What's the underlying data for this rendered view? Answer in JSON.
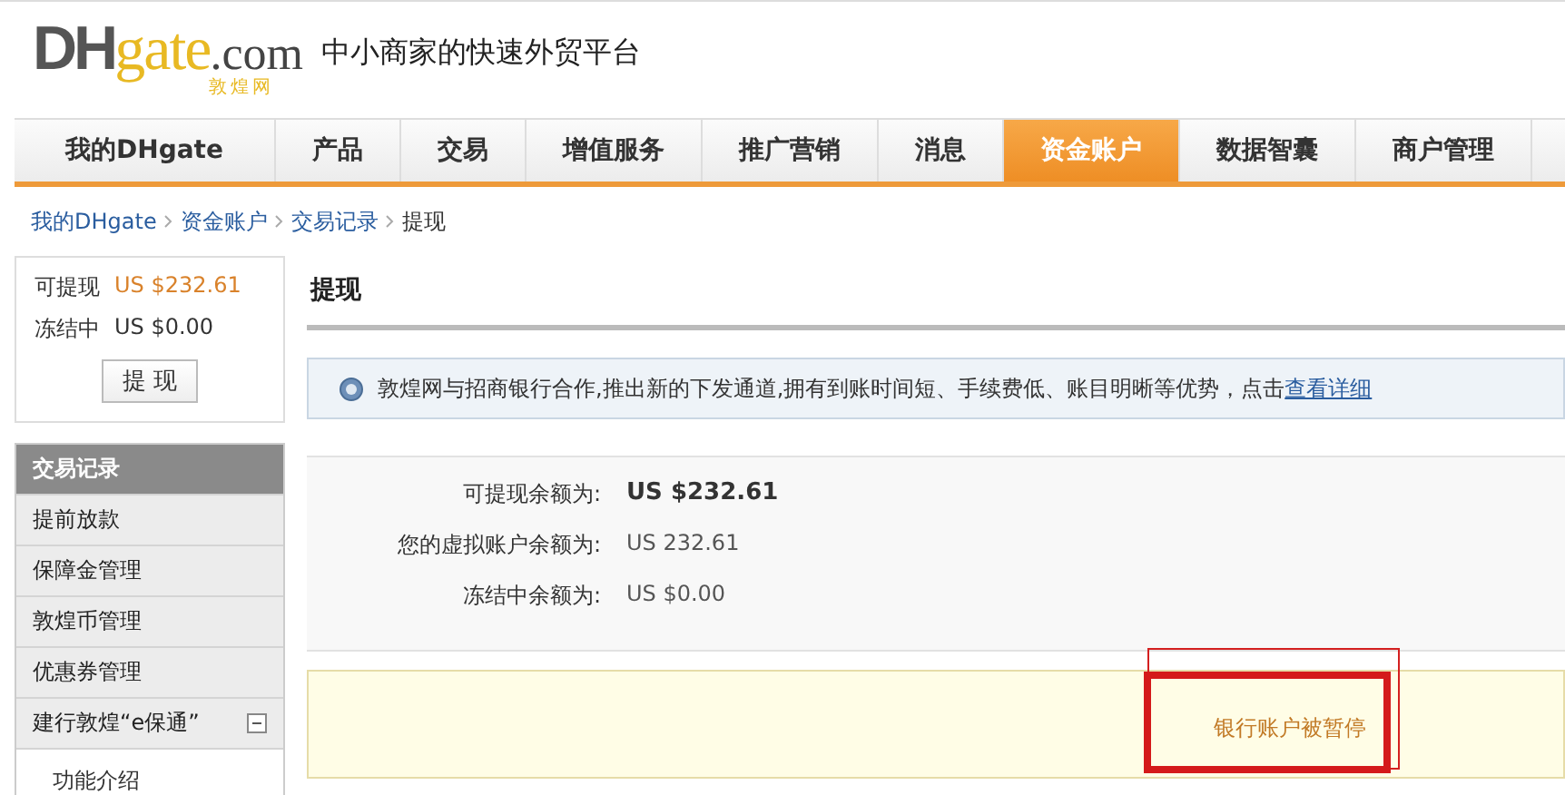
{
  "header": {
    "logo": {
      "brand_dark": "DH",
      "brand_gold": "gate",
      ".com": ".com",
      "subtitle": "敦煌网"
    },
    "slogan": "中小商家的快速外贸平台"
  },
  "nav": [
    {
      "label": "我的DHgate",
      "selected": false
    },
    {
      "label": "产品",
      "selected": false
    },
    {
      "label": "交易",
      "selected": false
    },
    {
      "label": "增值服务",
      "selected": false
    },
    {
      "label": "推广营销",
      "selected": false
    },
    {
      "label": "消息",
      "selected": false
    },
    {
      "label": "资金账户",
      "selected": true
    },
    {
      "label": "数据智囊",
      "selected": false
    },
    {
      "label": "商户管理",
      "selected": false
    }
  ],
  "breadcrumb": [
    {
      "label": "我的DHgate",
      "link": true
    },
    {
      "label": "资金账户",
      "link": true
    },
    {
      "label": "交易记录",
      "link": true
    },
    {
      "label": "提现",
      "link": false
    }
  ],
  "sidebar": {
    "summary": [
      {
        "label": "可提现",
        "value": "US $232.61",
        "highlight": true
      },
      {
        "label": "冻结中",
        "value": "US $0.00",
        "highlight": false
      }
    ],
    "button": "提 现",
    "menu_title": "交易记录",
    "items": [
      {
        "label": "提前放款"
      },
      {
        "label": "保障金管理"
      },
      {
        "label": "敦煌币管理"
      },
      {
        "label": "优惠券管理"
      },
      {
        "label": "建行敦煌“e保通”",
        "expanded": true,
        "children": [
          {
            "label": "功能介绍"
          }
        ]
      }
    ]
  },
  "content": {
    "title": "提现",
    "notice": {
      "text": "敦煌网与招商银行合作,推出新的下发通道,拥有到账时间短、手续费低、账目明晰等优势，点击",
      "link": "查看详细"
    },
    "balances": [
      {
        "label": "可提现余额为:",
        "value": "US $232.61",
        "bold": true
      },
      {
        "label": "您的虚拟账户余额为:",
        "value": "US 232.61",
        "bold": false
      },
      {
        "label": "冻结中余额为:",
        "value": "US $0.00",
        "bold": false
      }
    ],
    "alert": "银行账户被暂停"
  }
}
